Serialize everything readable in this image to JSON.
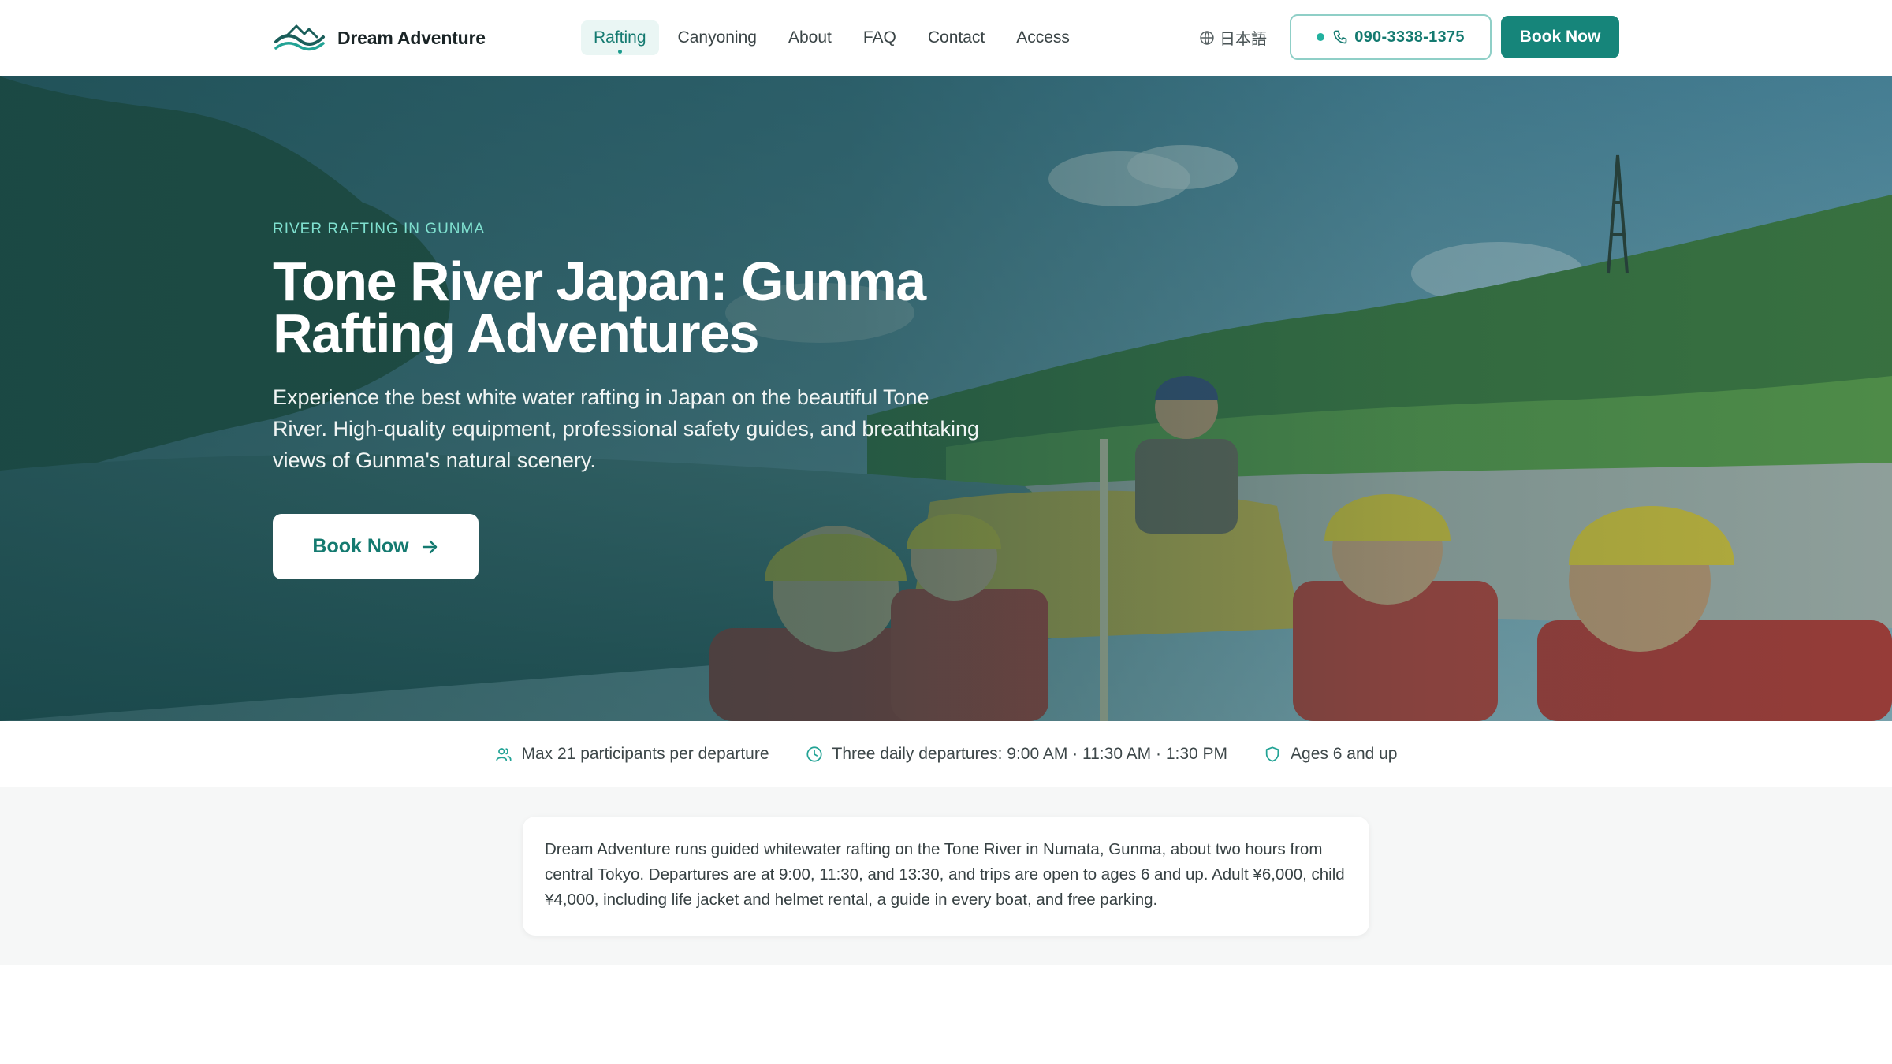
{
  "brand": {
    "name": "Dream Adventure",
    "accent": "#16857a",
    "accent_light": "#7fe0cf"
  },
  "nav": {
    "items": [
      {
        "label": "Rafting",
        "active": true
      },
      {
        "label": "Canyoning",
        "active": false
      },
      {
        "label": "About",
        "active": false
      },
      {
        "label": "FAQ",
        "active": false
      },
      {
        "label": "Contact",
        "active": false
      },
      {
        "label": "Access",
        "active": false
      }
    ]
  },
  "header": {
    "language_label": "日本語",
    "phone": "090-3338-1375",
    "book_label": "Book Now"
  },
  "hero": {
    "eyebrow": "RIVER RAFTING IN GUNMA",
    "title": "Tone River Japan: Gunma Rafting Adventures",
    "subtitle": "Experience the best white water rafting in Japan on the beautiful Tone River. High-quality equipment, professional safety guides, and breathtaking views of Gunma's natural scenery.",
    "cta_label": "Book Now"
  },
  "highlights": [
    {
      "icon": "users-icon",
      "text": "Max 21 participants per departure"
    },
    {
      "icon": "clock-icon",
      "text": "Three daily departures: 9:00 AM · 11:30 AM · 1:30 PM"
    },
    {
      "icon": "shield-icon",
      "text": "Ages 6 and up"
    }
  ],
  "summary": {
    "text": "Dream Adventure runs guided whitewater rafting on the Tone River in Numata, Gunma, about two hours from central Tokyo. Departures are at 9:00, 11:30, and 13:30, and trips are open to ages 6 and up. Adult ¥6,000, child ¥4,000, including life jacket and helmet rental, a guide in every boat, and free parking."
  }
}
